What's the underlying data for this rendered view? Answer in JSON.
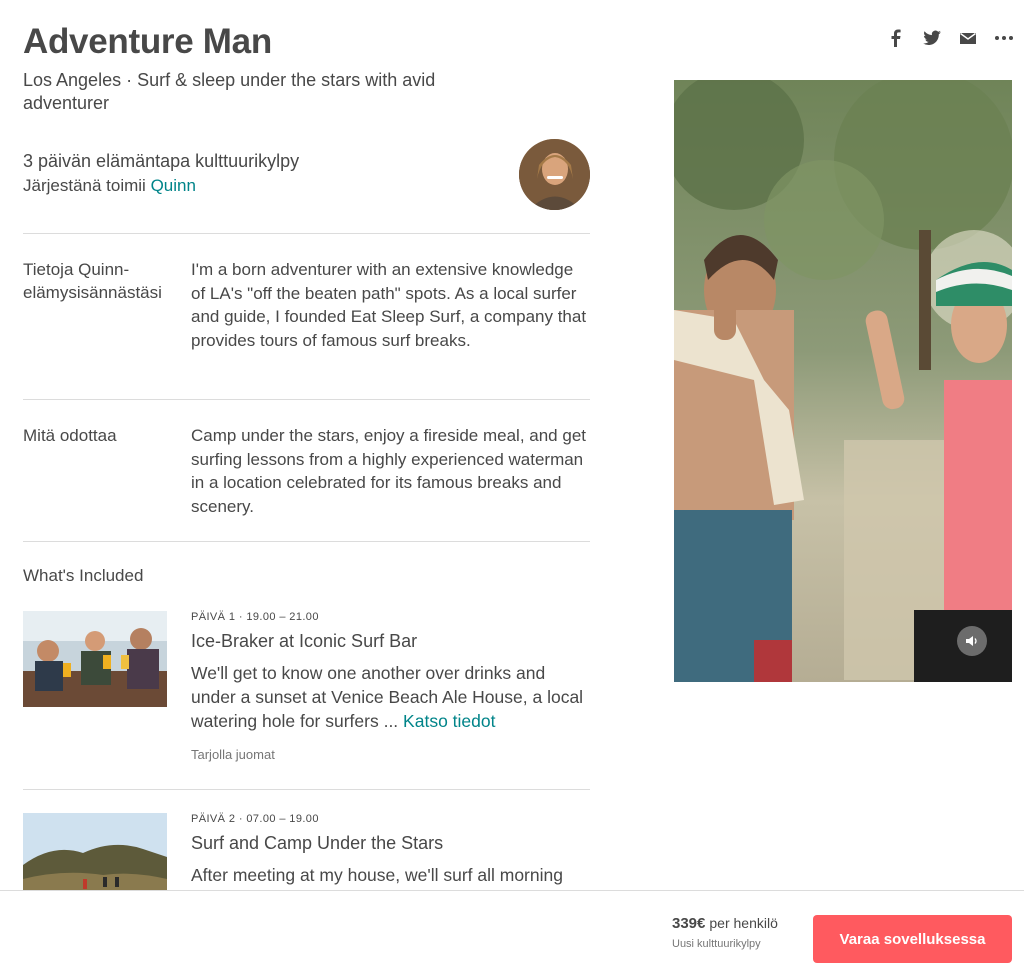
{
  "experience": {
    "title": "Adventure Man",
    "subtitle": "Los Angeles · Surf & sleep under the stars with avid adventurer"
  },
  "host": {
    "title": "3 päivän elämäntapa kulttuurikylpy",
    "by_prefix": "Järjestänä toimii",
    "name": "Quinn"
  },
  "sections": [
    {
      "label": "Tietoja Quinn-elämysisännästäsi",
      "text": "I'm a born adventurer with an extensive knowledge of LA's \"off the beaten path\" spots. As a local surfer and guide, I founded Eat Sleep Surf, a company that provides tours of famous surf breaks."
    },
    {
      "label": "Mitä odottaa",
      "text": "Camp under the stars, enjoy a fireside meal, and get surfing lessons from a highly experienced waterman in a location celebrated for its famous breaks and scenery."
    }
  ],
  "included": {
    "heading": "What's Included",
    "days": [
      {
        "time": "PÄIVÄ 1 · 19.00 – 21.00",
        "title": "Ice-Braker at Iconic Surf Bar",
        "desc": "We'll get to know one another over drinks and under a sunset at Venice Beach Ale House, a local watering hole for surfers ... ",
        "link": "Katso tiedot",
        "extra": "Tarjolla juomat"
      },
      {
        "time": "PÄIVÄ 2 · 07.00 – 19.00",
        "title": "Surf and Camp Under the Stars",
        "desc": "After meeting at my house, we'll surf all morning"
      }
    ]
  },
  "share": {
    "icons": [
      "facebook-icon",
      "twitter-icon",
      "email-icon",
      "more-icon"
    ]
  },
  "footer": {
    "price": "339€",
    "per": "per henkilö",
    "sub": "Uusi kulttuurikylpy",
    "book_label": "Varaa sovelluksessa"
  },
  "colors": {
    "accent": "#ff5a5f",
    "link": "#008489",
    "text": "#484848"
  }
}
